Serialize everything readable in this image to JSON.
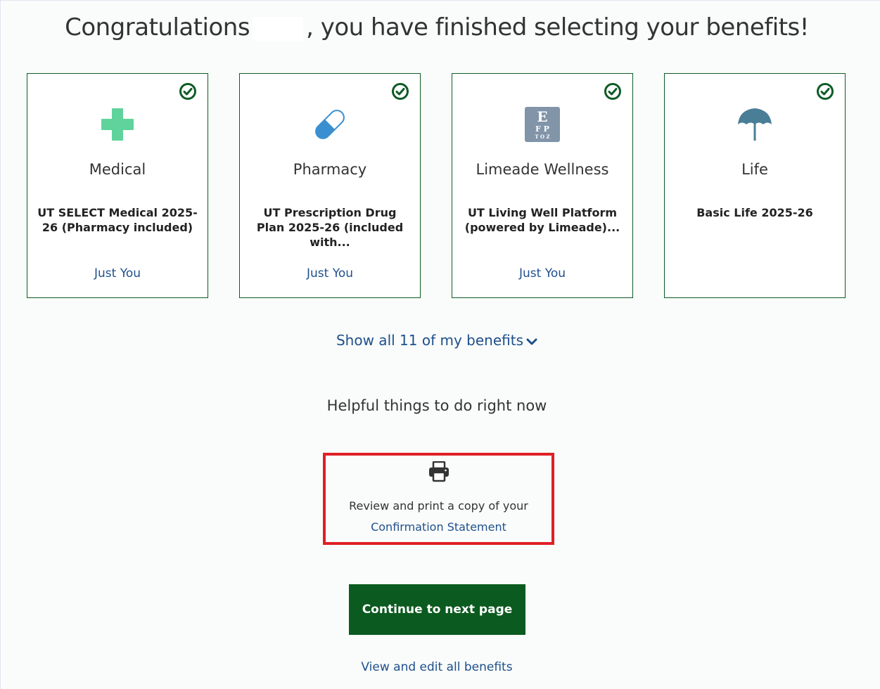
{
  "header": {
    "title_before": "Congratulations",
    "title_after": ", you have finished selecting your benefits!"
  },
  "cards": [
    {
      "category": "Medical",
      "plan": "UT SELECT Medical 2025-26 (Pharmacy included)",
      "coverage": "Just You",
      "icon": "medical-cross-icon",
      "status_icon": "checkmark-circle-icon"
    },
    {
      "category": "Pharmacy",
      "plan": "UT Prescription Drug Plan 2025-26 (included with...",
      "coverage": "Just You",
      "icon": "pill-capsule-icon",
      "status_icon": "checkmark-circle-icon"
    },
    {
      "category": "Limeade Wellness",
      "plan": "UT Living Well Platform (powered by Limeade)...",
      "coverage": "Just You",
      "icon": "eye-chart-icon",
      "status_icon": "checkmark-circle-icon"
    },
    {
      "category": "Life",
      "plan": "Basic Life 2025-26",
      "coverage": "",
      "icon": "umbrella-icon",
      "status_icon": "checkmark-circle-icon"
    }
  ],
  "show_all": {
    "label": "Show all 11 of my benefits"
  },
  "helpful": {
    "heading": "Helpful things to do right now"
  },
  "print_action": {
    "text": "Review and print a copy of your",
    "link": "Confirmation Statement"
  },
  "actions": {
    "continue_label": "Continue to next page",
    "view_edit_label": "View and edit all benefits"
  },
  "colors": {
    "brand_green": "#0b5a1f",
    "check_green": "#0f5b26",
    "link_blue": "#1f4f8c",
    "highlight_red": "#e01f26",
    "medical_green": "#5fd39b",
    "pill_blue": "#3a8fd0"
  }
}
